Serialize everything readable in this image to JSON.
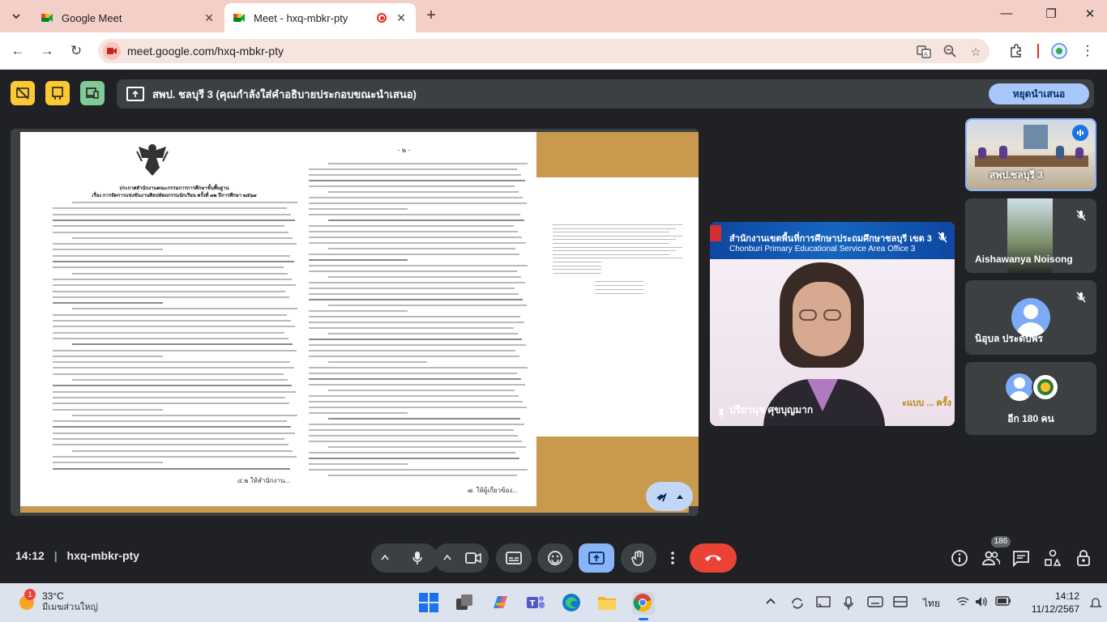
{
  "browser": {
    "tabs": [
      {
        "title": "Google Meet",
        "active": false
      },
      {
        "title": "Meet - hxq-mbkr-pty",
        "active": true
      }
    ],
    "url": "meet.google.com/hxq-mbkr-pty"
  },
  "meet": {
    "presenting_banner": "สพป. ชลบุรี 3 (คุณกำลังใส่คำอธิบายประกอบขณะนำเสนอ)",
    "stop_presenting_label": "หยุดนำเสนอ",
    "clock": "14:12",
    "meeting_code": "hxq-mbkr-pty",
    "participant_count": "186",
    "presentation": {
      "left_page": {
        "header": "ประกาศสำนักงานคณะกรรมการการศึกษาขั้นพื้นฐาน",
        "subject": "เรื่อง การจัดการแข่งขันงานศิลปหัตถกรรมนักเรียน ครั้งที่ ๗๒ ปีการศึกษา ๒๕๖๗",
        "footer": "๔.๒ ให้สำนักงาน..."
      },
      "right_page": {
        "page_number": "- ๒ -",
        "footer": "๗. ให้ผู้เกี่ยวข้อง..."
      }
    },
    "tiles": [
      {
        "name": "สพป.ชลบุรี 3"
      },
      {
        "name": "Aishawanya Noisong"
      },
      {
        "name": "นิอุบล ประดับพร"
      },
      {
        "name": "อีก 180 คน"
      }
    ],
    "speaker": {
      "name": "ปรียานุช ศุขบุญมาก",
      "backdrop_thai": "สำนักงานเขตพื้นที่การศึกษาประถมศึกษาชลบุรี เขต 3",
      "backdrop_en": "Chonburi Primary Educational Service Area Office 3",
      "backdrop_bottom": "ะแบบ ... ครั้ง"
    },
    "colors": {
      "accent": "#a8c7fa",
      "hangup": "#ea4335",
      "presenting_active": "#8ab4f8",
      "doc_gold": "#c99a4d"
    }
  },
  "taskbar": {
    "temperature": "33°C",
    "weather_text": "มีเมฆส่วนใหญ่",
    "weather_badge": "1",
    "language": "ไทย",
    "time": "14:12",
    "date": "11/12/2567"
  }
}
